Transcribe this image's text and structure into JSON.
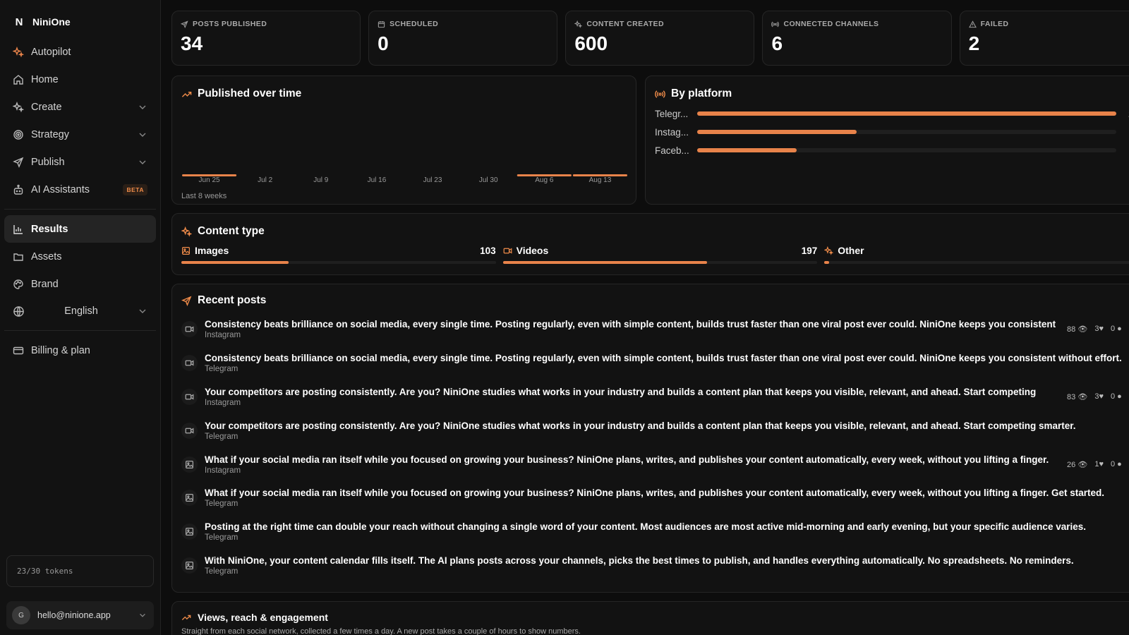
{
  "brand": {
    "name": "NiniOne",
    "logo": "N"
  },
  "nav": {
    "items": [
      {
        "label": "Autopilot",
        "icon": "sparkle-icon",
        "chevron": false,
        "active": false
      },
      {
        "label": "Home",
        "icon": "home-icon",
        "chevron": false,
        "active": false
      },
      {
        "label": "Create",
        "icon": "sparkle-icon",
        "chevron": true,
        "active": false
      },
      {
        "label": "Strategy",
        "icon": "target-icon",
        "chevron": true,
        "active": false
      },
      {
        "label": "Publish",
        "icon": "send-icon",
        "chevron": true,
        "active": false
      },
      {
        "label": "AI Assistants",
        "icon": "bot-icon",
        "badge": "BETA",
        "active": false
      }
    ],
    "secondary": [
      {
        "label": "Results",
        "icon": "bar-chart-icon",
        "active": true
      },
      {
        "label": "Assets",
        "icon": "folder-icon",
        "active": false
      },
      {
        "label": "Brand",
        "icon": "palette-icon",
        "active": false
      }
    ],
    "language": "English",
    "billing": "Billing & plan"
  },
  "tokens": "23/30 tokens",
  "account": {
    "initial": "G",
    "email": "hello@ninione.app"
  },
  "stats": [
    {
      "label": "POSTS PUBLISHED",
      "value": "34",
      "icon": "send-icon"
    },
    {
      "label": "SCHEDULED",
      "value": "0",
      "icon": "calendar-icon"
    },
    {
      "label": "CONTENT CREATED",
      "value": "600",
      "icon": "sparkle-icon"
    },
    {
      "label": "CONNECTED CHANNELS",
      "value": "6",
      "icon": "broadcast-icon"
    },
    {
      "label": "FAILED",
      "value": "2",
      "icon": "warning-icon"
    }
  ],
  "published_over_time": {
    "title": "Published over time",
    "subtitle": "Last 8 weeks"
  },
  "chart_data": {
    "type": "bar",
    "title": "Published over time",
    "categories": [
      "Jun 25",
      "Jul 2",
      "Jul 9",
      "Jul 16",
      "Jul 23",
      "Jul 30",
      "Aug 6",
      "Aug 13"
    ],
    "values": [
      1,
      0,
      0,
      0,
      0,
      0,
      1,
      1
    ],
    "xlabel": "",
    "ylabel": "",
    "grid": false
  },
  "by_platform": {
    "title": "By platform",
    "max": 21,
    "rows": [
      {
        "name": "Telegr...",
        "value": 21
      },
      {
        "name": "Instag...",
        "value": 8
      },
      {
        "name": "Faceb...",
        "value": 5
      }
    ]
  },
  "content_type": {
    "title": "Content type",
    "items": [
      {
        "label": "Images",
        "value": 103,
        "fraction": 0.34,
        "icon": "image-icon"
      },
      {
        "label": "Videos",
        "value": 197,
        "fraction": 0.65,
        "icon": "video-icon"
      },
      {
        "label": "Other",
        "value": 4,
        "fraction": 0.013,
        "icon": "sparkle-icon"
      }
    ]
  },
  "recent_posts": {
    "title": "Recent posts",
    "posts": [
      {
        "type": "video",
        "text": "Consistency beats brilliance on social media, every single time. Posting regularly, even with simple content, builds trust faster than one viral post ever could. NiniOne keeps you consistent",
        "platform": "Instagram",
        "views": "88",
        "likes": "3",
        "comments": "0"
      },
      {
        "type": "video",
        "text": "Consistency beats brilliance on social media, every single time. Posting regularly, even with simple content, builds trust faster than one viral post ever could. NiniOne keeps you consistent without effort.",
        "platform": "Telegram"
      },
      {
        "type": "video",
        "text": "Your competitors are posting consistently. Are you? NiniOne studies what works in your industry and builds a content plan that keeps you visible, relevant, and ahead. Start competing",
        "platform": "Instagram",
        "views": "83",
        "likes": "3",
        "comments": "0"
      },
      {
        "type": "video",
        "text": "Your competitors are posting consistently. Are you? NiniOne studies what works in your industry and builds a content plan that keeps you visible, relevant, and ahead. Start competing smarter.",
        "platform": "Telegram"
      },
      {
        "type": "image",
        "text": "What if your social media ran itself while you focused on growing your business? NiniOne plans, writes, and publishes your content automatically, every week, without you lifting a finger.",
        "platform": "Instagram",
        "views": "26",
        "likes": "1",
        "comments": "0"
      },
      {
        "type": "image",
        "text": "What if your social media ran itself while you focused on growing your business? NiniOne plans, writes, and publishes your content automatically, every week, without you lifting a finger. Get started.",
        "platform": "Telegram"
      },
      {
        "type": "image",
        "text": "Posting at the right time can double your reach without changing a single word of your content. Most audiences are most active mid-morning and early evening, but your specific audience varies.",
        "platform": "Telegram"
      },
      {
        "type": "image",
        "text": "With NiniOne, your content calendar fills itself. The AI plans posts across your channels, picks the best times to publish, and handles everything automatically. No spreadsheets. No reminders.",
        "platform": "Telegram"
      }
    ]
  },
  "views_section": {
    "title": "Views, reach & engagement",
    "description": "Straight from each social network, collected a few times a day. A new post takes a couple of hours to show numbers."
  },
  "colors": {
    "accent": "#e8834a",
    "background": "#0d0d0d",
    "card": "#121212"
  }
}
